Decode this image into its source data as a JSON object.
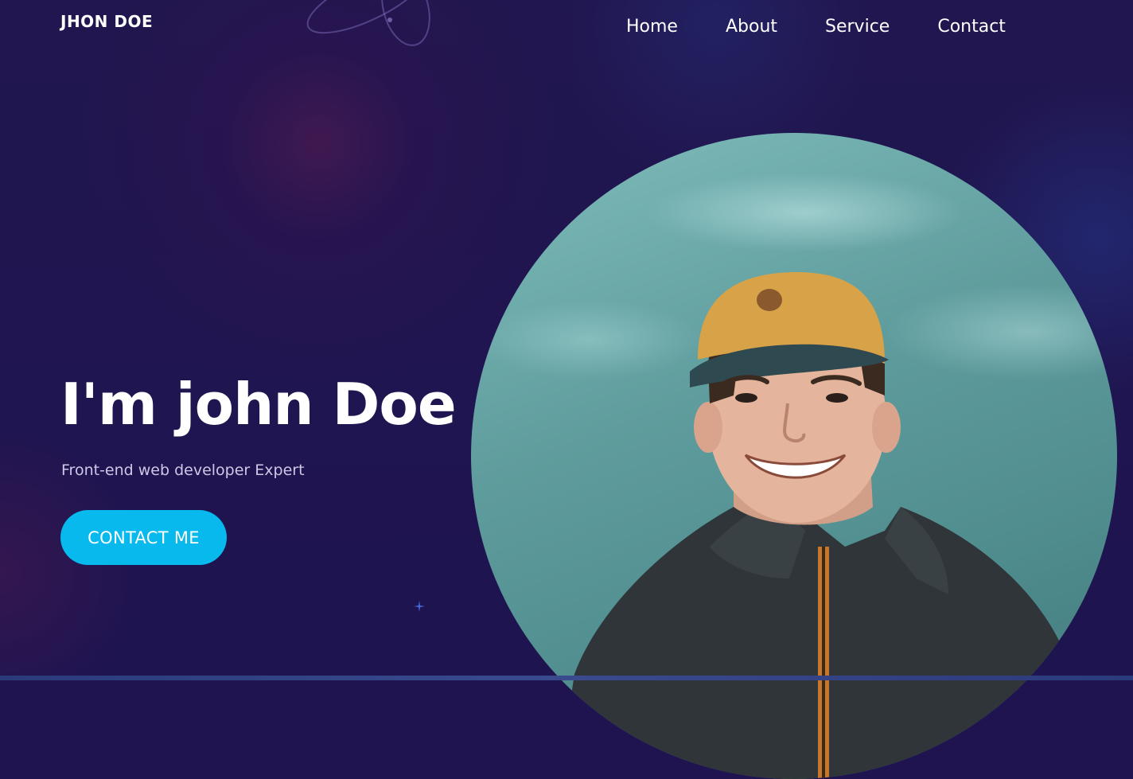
{
  "header": {
    "brand": "JHON DOE",
    "nav": [
      {
        "label": "Home"
      },
      {
        "label": "About"
      },
      {
        "label": "Service"
      },
      {
        "label": "Contact"
      }
    ]
  },
  "hero": {
    "title": "I'm john Doe",
    "subtitle": "Front-end web developer Expert",
    "cta_label": "CONTACT ME"
  },
  "colors": {
    "background": "#1f1450",
    "accent": "#08b9ee",
    "text": "#ffffff",
    "subtitle": "#cfc7e6"
  },
  "icons": {
    "decor_orbit": "orbit-decoration-icon",
    "decor_star": "sparkle-star-icon"
  }
}
